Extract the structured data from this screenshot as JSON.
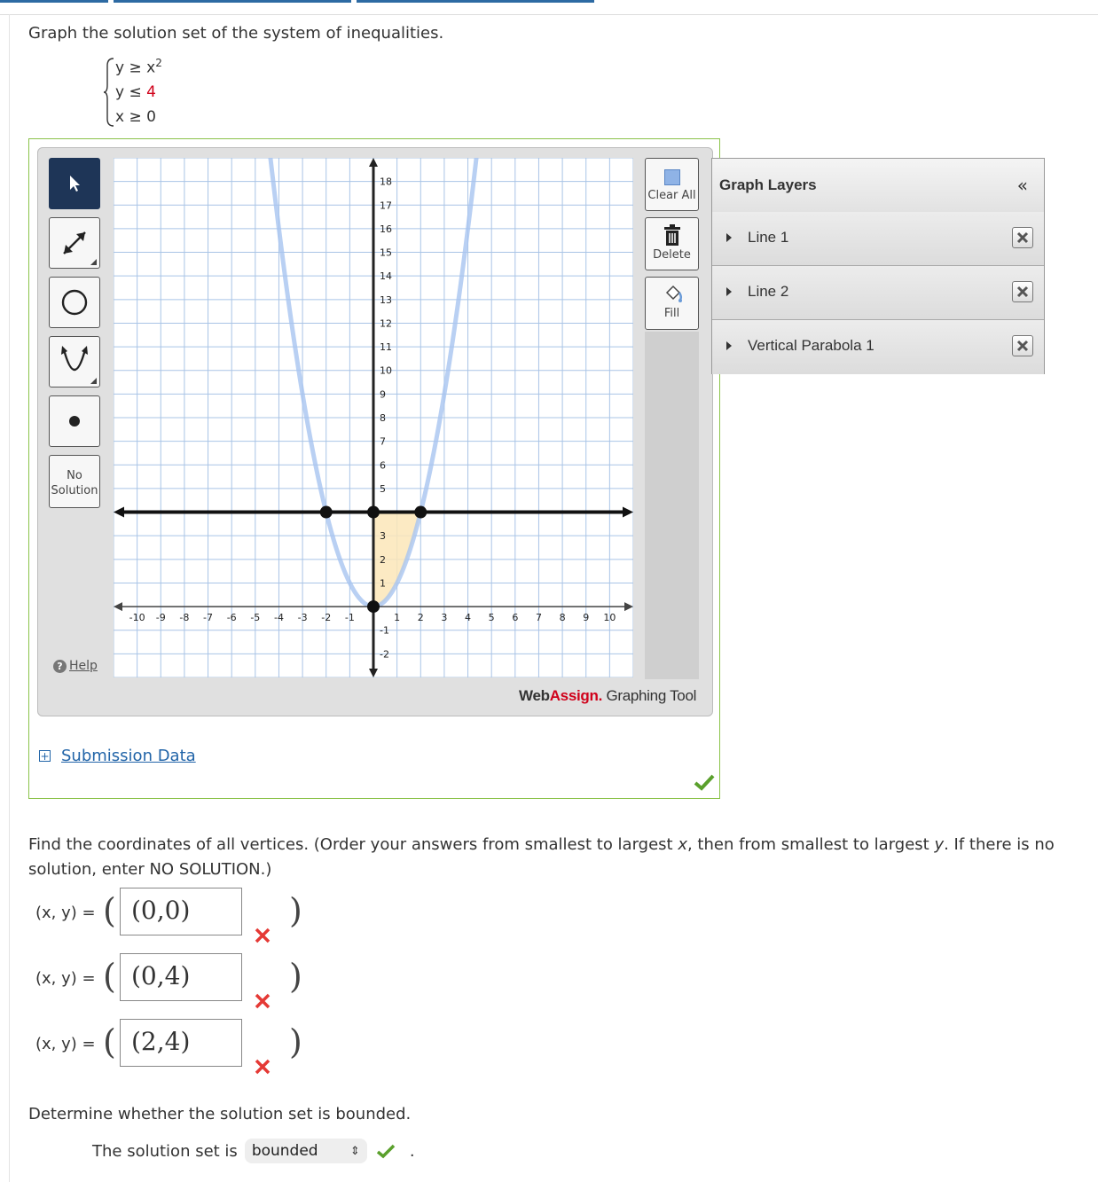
{
  "question": {
    "prompt": "Graph the solution set of the system of inequalities.",
    "inequalities": [
      {
        "left": "y ≥ x",
        "exp": "2",
        "right": ""
      },
      {
        "left": "y ≤ ",
        "exp": "",
        "right": "4"
      },
      {
        "left": "x ≥ 0",
        "exp": "",
        "right": ""
      }
    ]
  },
  "toolbar": {
    "tools": [
      {
        "name": "pointer-tool",
        "icon": "arrow-cursor-icon"
      },
      {
        "name": "line-tool",
        "icon": "line-segment-icon"
      },
      {
        "name": "circle-tool",
        "icon": "circle-icon"
      },
      {
        "name": "parabola-tool",
        "icon": "parabola-icon"
      },
      {
        "name": "point-tool",
        "icon": "point-icon"
      }
    ],
    "no_solution": "No Solution",
    "help": "Help",
    "clear_all": "Clear All",
    "delete": "Delete",
    "fill": "Fill",
    "brand_web": "Web",
    "brand_assign": "Assign.",
    "brand_tool": "Graphing Tool"
  },
  "graph": {
    "x_ticks": [
      "-10",
      "-9",
      "-8",
      "-7",
      "-6",
      "-5",
      "-4",
      "-3",
      "-2",
      "-1",
      "1",
      "2",
      "3",
      "4",
      "5",
      "6",
      "7",
      "8",
      "9",
      "10"
    ],
    "y_ticks": [
      "18",
      "17",
      "16",
      "15",
      "14",
      "13",
      "12",
      "11",
      "10",
      "9",
      "8",
      "7",
      "6",
      "5",
      "3",
      "2",
      "1",
      "-1",
      "-2"
    ],
    "xlim": [
      -11,
      11
    ],
    "ylim": [
      -3,
      19
    ],
    "line_y": 4,
    "parabola": "y = x^2",
    "points": [
      [
        -2,
        4
      ],
      [
        0,
        4
      ],
      [
        2,
        4
      ],
      [
        0,
        0
      ]
    ],
    "shaded_region": "y ≥ x², y ≤ 4, x ≥ 0",
    "colors": {
      "grid": "#a9c4e6",
      "axis": "#222222",
      "parabola": "#a8c4f0",
      "fill": "#fbe6b8"
    }
  },
  "layers": {
    "title": "Graph Layers",
    "collapse": "«",
    "items": [
      {
        "label": "Line 1"
      },
      {
        "label": "Line 2"
      },
      {
        "label": "Vertical Parabola 1"
      }
    ]
  },
  "submission": {
    "label": "Submission Data"
  },
  "vertices": {
    "prompt_a": "Find the coordinates of all vertices. (Order your answers from smallest to largest ",
    "x": "x",
    "prompt_b": ", then from smallest to largest ",
    "y": "y",
    "prompt_c": ". If there is no solution, enter NO SOLUTION.)",
    "label": "(x, y) =",
    "answers": [
      {
        "value": "(0,0)",
        "status": "incorrect"
      },
      {
        "value": "(0,4)",
        "status": "incorrect"
      },
      {
        "value": "(2,4)",
        "status": "incorrect"
      }
    ]
  },
  "bounded": {
    "prompt": "Determine whether the solution set is bounded.",
    "lead": "The solution set is",
    "selected": "bounded",
    "status": "correct",
    "end": "."
  }
}
